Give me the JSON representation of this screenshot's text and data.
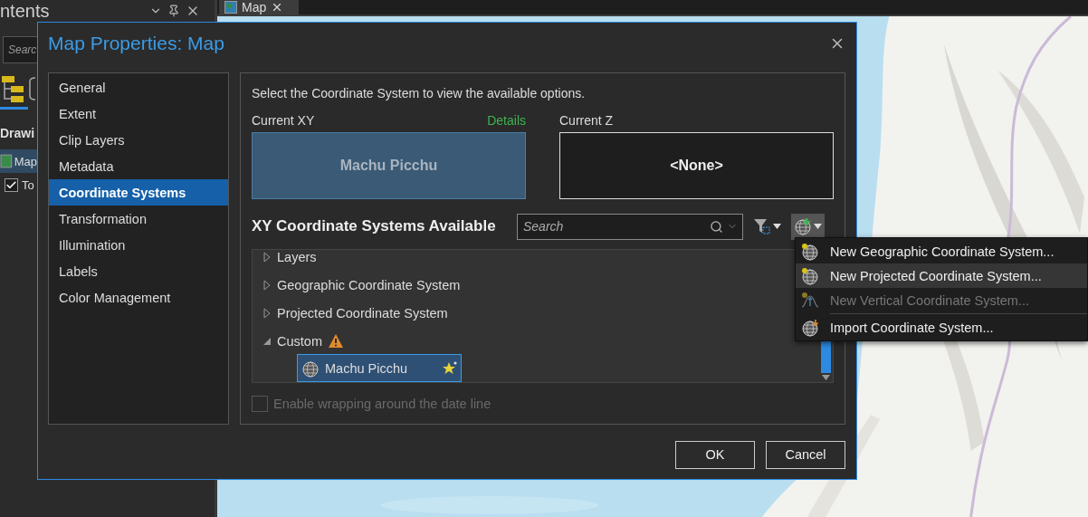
{
  "contents_panel": {
    "title": "ntents",
    "search_placeholder": "Searc",
    "section": "Drawi",
    "map_item": {
      "label": "Map",
      "selected": true
    },
    "layer": {
      "label": "To",
      "checked": true
    }
  },
  "map_tab": {
    "label": "Map",
    "selected": true
  },
  "dialog": {
    "title": "Map Properties: Map",
    "nav": [
      {
        "label": "General",
        "selected": false
      },
      {
        "label": "Extent",
        "selected": false
      },
      {
        "label": "Clip Layers",
        "selected": false
      },
      {
        "label": "Metadata",
        "selected": false
      },
      {
        "label": "Coordinate Systems",
        "selected": true
      },
      {
        "label": "Transformation",
        "selected": false
      },
      {
        "label": "Illumination",
        "selected": false
      },
      {
        "label": "Labels",
        "selected": false
      },
      {
        "label": "Color Management",
        "selected": false
      }
    ],
    "instruction": "Select the Coordinate System to view the available options.",
    "current_xy": {
      "label": "Current XY",
      "details_link": "Details",
      "value": "Machu Picchu"
    },
    "current_z": {
      "label": "Current Z",
      "value": "<None>"
    },
    "available": {
      "title": "XY Coordinate Systems Available",
      "search": {
        "placeholder": "Search"
      },
      "tree": [
        {
          "label": "Layers",
          "expanded": false,
          "warning": false
        },
        {
          "label": "Geographic Coordinate System",
          "expanded": false,
          "warning": false
        },
        {
          "label": "Projected Coordinate System",
          "expanded": false,
          "warning": false
        },
        {
          "label": "Custom",
          "expanded": true,
          "warning": true,
          "children": [
            {
              "label": "Machu Picchu",
              "selected": true
            }
          ]
        }
      ]
    },
    "wrap_checkbox": {
      "label": "Enable wrapping around the date line",
      "checked": false,
      "disabled": true
    },
    "buttons": [
      "OK",
      "Cancel"
    ]
  },
  "menu": {
    "items": [
      {
        "label": "New Geographic Coordinate System...",
        "kind": "geographic",
        "highlighted": false,
        "disabled": false
      },
      {
        "label": "New Projected Coordinate System...",
        "kind": "projected",
        "highlighted": true,
        "disabled": false
      },
      {
        "label": "New Vertical Coordinate System...",
        "kind": "vertical",
        "highlighted": false,
        "disabled": true
      },
      {
        "label": "Import Coordinate System...",
        "kind": "import",
        "highlighted": false,
        "disabled": false
      }
    ]
  }
}
